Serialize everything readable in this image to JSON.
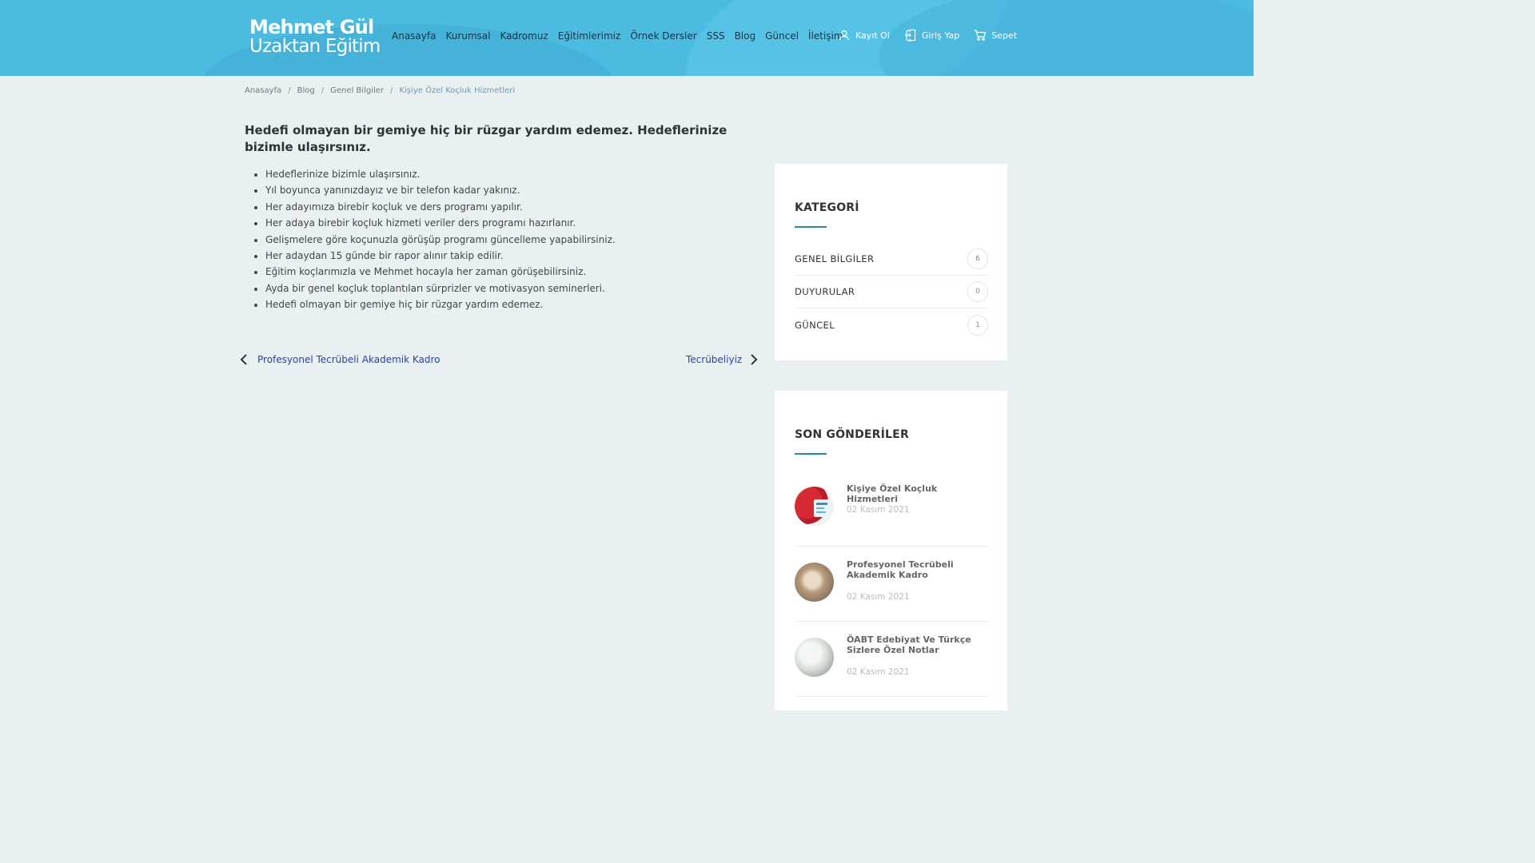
{
  "brand": {
    "line1": "Mehmet Gül",
    "line2": "Uzaktan Eğitim"
  },
  "nav": [
    "Anasayfa",
    "Kurumsal",
    "Kadromuz",
    "Eğitimlerimiz",
    "Örnek Dersler",
    "SSS",
    "Blog",
    "Güncel",
    "İletişim"
  ],
  "user_actions": {
    "register": "Kayıt Ol",
    "login": "Giriş Yap",
    "cart": "Sepet"
  },
  "breadcrumb": {
    "items": [
      "Anasayfa",
      "Blog",
      "Genel Bilgiler"
    ],
    "current": "Kişiye Özel Koçluk Hizmetleri",
    "separator": "/"
  },
  "article": {
    "title": "Hedefi olmayan bir gemiye hiç bir rüzgar yardım edemez. Hedeflerinize bizimle ulaşırsınız.",
    "bullets": [
      "Hedeflerinize bizimle ulaşırsınız.",
      "Yıl boyunca yanınızdayız ve bir telefon kadar yakınız.",
      "Her adayımıza birebir koçluk ve ders programı yapılır.",
      "Her adaya birebir koçluk hizmeti veriler ders programı hazırlanır.",
      "Gelişmelere göre koçunuzla görüşüp programı güncelleme yapabilirsiniz.",
      "Her adaydan 15 günde bir rapor alınır takip edilir.",
      "Eğitim koçlarımızla ve Mehmet hocayla her zaman görüşebilirsiniz.",
      "Ayda bir genel koçluk toplantıları sürprizler ve motivasyon seminerleri.",
      "Hedefi olmayan bir gemiye hiç bir rüzgar yardım edemez."
    ],
    "prev_post": "Profesyonel Tecrübeli Akademik Kadro",
    "next_post": "Tecrübeliyiz"
  },
  "sidebar": {
    "categories_title": "KATEGORİ",
    "categories": [
      {
        "name": "GENEL BİLGİLER",
        "count": "6"
      },
      {
        "name": "DUYURULAR",
        "count": "0"
      },
      {
        "name": "GÜNCEL",
        "count": "1"
      }
    ],
    "recent_title": "SON GÖNDERİLER",
    "recent": [
      {
        "title": "Kişiye Özel Koçluk Hizmetleri",
        "date": "02 Kasım 2021"
      },
      {
        "title": "Profesyonel Tecrübeli Akademik Kadro",
        "date": "02 Kasım 2021"
      },
      {
        "title": "ÖABT Edebiyat Ve Türkçe Sizlere Özel Notlar",
        "date": "02 Kasım 2021"
      }
    ]
  },
  "colors": {
    "header": "#4bbce0",
    "page_bg": "#e8f0f2",
    "link": "#2b3fa8",
    "accent_underline": "#2d8a9c"
  },
  "icons": {
    "register": "user-icon",
    "login": "login-icon",
    "cart": "cart-icon",
    "prev": "chevron-left-icon",
    "next": "chevron-right-icon"
  }
}
